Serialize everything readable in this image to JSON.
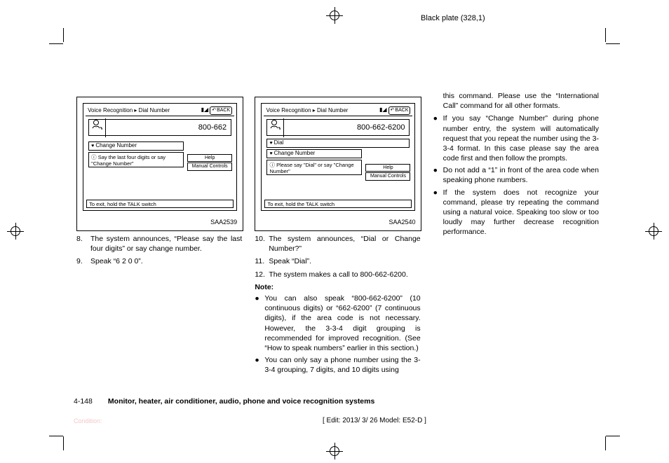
{
  "meta": {
    "black_plate": "Black plate (328,1)",
    "edit": "[ Edit: 2013/ 3/ 26   Model:  E52-D ]",
    "condition": "Condition:"
  },
  "footer": {
    "page": "4-148",
    "title": "Monitor, heater, air conditioner, audio, phone and voice recognition systems"
  },
  "ss1": {
    "bread1": "Voice Recognition",
    "bread2": "Dial Number",
    "back": "BACK",
    "number": "800-662",
    "change": "Change Number",
    "help": "Help",
    "manual": "Manual Controls",
    "hint": "Say the last four digits or say \"Change Number\"",
    "foot": "To exit, hold the TALK switch",
    "label": "SAA2539"
  },
  "ss2": {
    "bread1": "Voice Recognition",
    "bread2": "Dial Number",
    "back": "BACK",
    "number": "800-662-6200",
    "dial": "Dial",
    "change": "Change Number",
    "help": "Help",
    "manual": "Manual Controls",
    "hint": "Please say \"Dial\" or say \"Change Number\"",
    "foot": "To exit, hold the TALK switch",
    "label": "SAA2540"
  },
  "col1": {
    "s8n": "8.",
    "s8": "The system announces, “Please say the last four digits” or say change number.",
    "s9n": "9.",
    "s9": "Speak “6 2 0 0”."
  },
  "col2": {
    "s10n": "10.",
    "s10": "The system announces, “Dial or Change Number?”",
    "s11n": "11.",
    "s11": "Speak “Dial”.",
    "s12n": "12.",
    "s12": "The system makes a call to 800-662-6200.",
    "note": "Note:",
    "b1": "You can also speak “800-662-6200” (10 continuous digits) or “662-6200” (7 continuous digits), if the area code is not necessary. However, the 3-3-4 digit grouping is recommended for improved recognition. (See “How to speak numbers” earlier in this section.)",
    "b2": "You can only say a phone number using the 3-3-4 grouping, 7 digits, and 10 digits using"
  },
  "col3": {
    "cont": "this command. Please use the “International Call” command for all other formats.",
    "b1": "If you say “Change Number” during phone number entry, the system will automatically request that you repeat the number using the 3-3-4 format. In this case please say the area code first and then follow the prompts.",
    "b2": "Do not add a “1” in front of the area code when speaking phone numbers.",
    "b3": "If the system does not recognize your command, please try repeating the command using a natural voice. Speaking too slow or too loudly may further decrease recognition performance."
  }
}
